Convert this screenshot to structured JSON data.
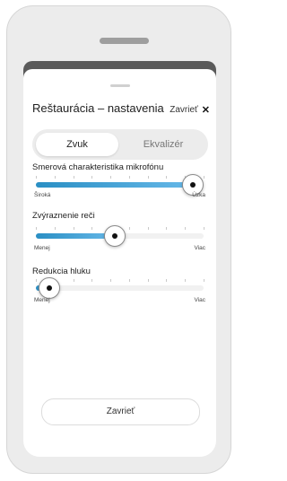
{
  "sheet": {
    "title": "Reštaurácia – nastavenia",
    "close_label": "Zavrieť",
    "close_icon": "close-x-icon"
  },
  "tabs": [
    {
      "label": "Zvuk",
      "active": true
    },
    {
      "label": "Ekvalizér",
      "active": false
    }
  ],
  "sliders": [
    {
      "label": "Smerová charakteristika mikrofónu",
      "min_label": "Široká",
      "max_label": "Úzka",
      "value_fraction": 1.0
    },
    {
      "label": "Zvýraznenie reči",
      "min_label": "Menej",
      "max_label": "Viac",
      "value_fraction": 0.47
    },
    {
      "label": "Redukcia hluku",
      "min_label": "Menej",
      "max_label": "Viac",
      "value_fraction": 0.08
    }
  ],
  "footer": {
    "button_label": "Zavrieť"
  },
  "colors": {
    "accent": "#3a9ad4",
    "sheet_bg": "#ffffff",
    "backdrop": "#ececec"
  }
}
